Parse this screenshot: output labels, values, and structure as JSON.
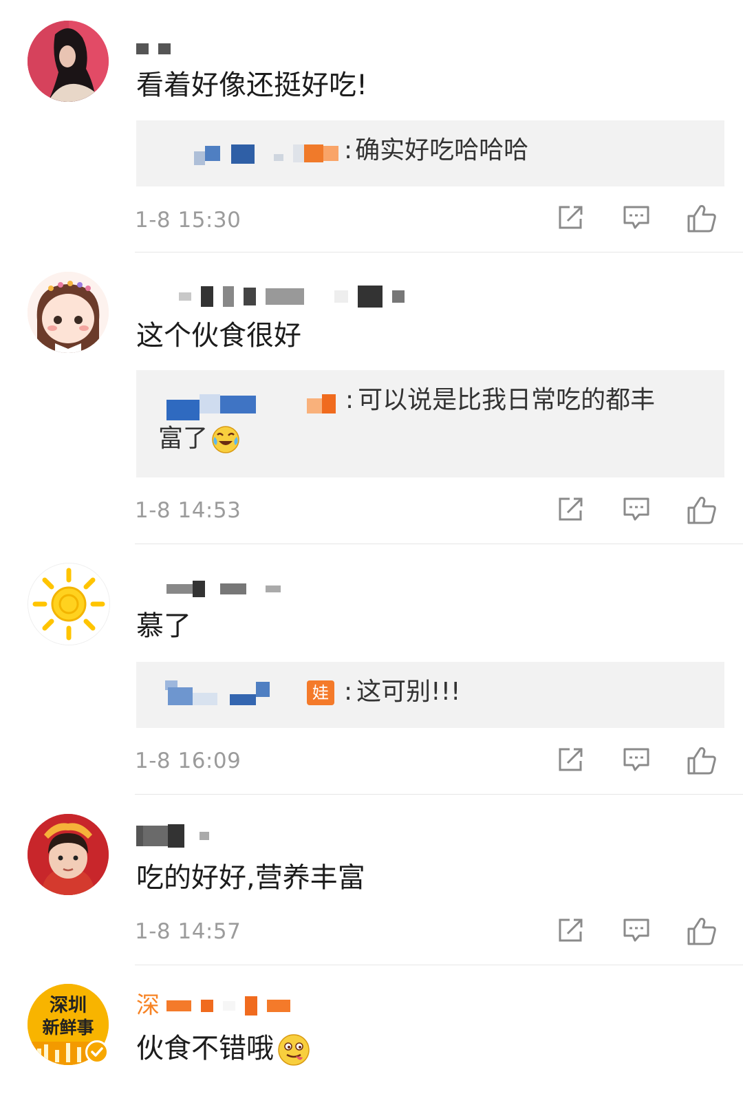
{
  "comments": [
    {
      "username": "",
      "text": "看着好像还挺好吃!",
      "reply": {
        "prefix": ":",
        "text": "确实好吃哈哈哈"
      },
      "time": "1-8 15:30"
    },
    {
      "username": "",
      "text": "这个伙食很好",
      "reply": {
        "prefix": ":",
        "text": "可以说是比我日常吃的都丰",
        "text2": "富了"
      },
      "time": "1-8 14:53"
    },
    {
      "username": "",
      "text": "慕了",
      "reply": {
        "prefix": ":",
        "badge": "娃",
        "text": "这可别!!!"
      },
      "time": "1-8 16:09"
    },
    {
      "username": "",
      "text": "吃的好好,营养丰富",
      "time": "1-8 14:57"
    },
    {
      "username": "深",
      "avatar_text": [
        "深圳",
        "新鲜事"
      ],
      "text": "伙食不错哦"
    }
  ],
  "icons": {
    "share": "share-icon",
    "comment": "comment-icon",
    "like": "like-icon"
  },
  "colors": {
    "background": "#ffffff",
    "reply_background": "#f2f2f2",
    "meta_text": "#9b9b9b",
    "official_name": "#f78324"
  }
}
